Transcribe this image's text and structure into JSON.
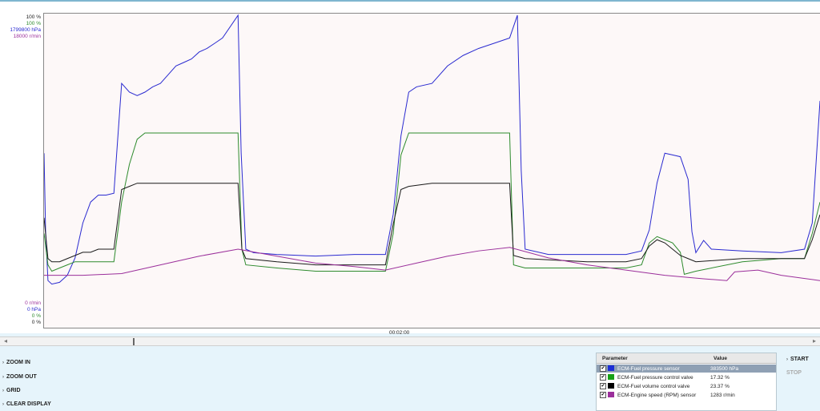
{
  "chart": {
    "y_axis_top": [
      {
        "label": "100 %",
        "color": "#1a1a1a"
      },
      {
        "label": "100 %",
        "color": "#2e8b2e"
      },
      {
        "label": "1799800 hPa",
        "color": "#2a2ad0"
      },
      {
        "label": "18000 r/min",
        "color": "#9b2f9b"
      }
    ],
    "y_axis_bottom": [
      {
        "label": "0 r/min",
        "color": "#9b2f9b"
      },
      {
        "label": "0 hPa",
        "color": "#2a2ad0"
      },
      {
        "label": "0 %",
        "color": "#2e8b2e"
      },
      {
        "label": "0 %",
        "color": "#1a1a1a"
      }
    ],
    "time_label": "00:02:00"
  },
  "chart_data": {
    "type": "line",
    "xlabel": "",
    "ylabel": "",
    "x_tick_labels": [
      "00:02:00"
    ],
    "grid": false,
    "series": [
      {
        "name": "ECM-Fuel pressure sensor",
        "color": "#2a2ad0",
        "unit": "hPa",
        "ylim": [
          0,
          1799800
        ],
        "points": [
          [
            0,
            1000000
          ],
          [
            0.2,
            560000
          ],
          [
            0.5,
            270000
          ],
          [
            1,
            250000
          ],
          [
            2,
            260000
          ],
          [
            3,
            300000
          ],
          [
            4,
            400000
          ],
          [
            5,
            600000
          ],
          [
            6,
            720000
          ],
          [
            7,
            760000
          ],
          [
            8,
            760000
          ],
          [
            9,
            770000
          ],
          [
            10,
            1400000
          ],
          [
            11,
            1350000
          ],
          [
            12,
            1330000
          ],
          [
            13,
            1350000
          ],
          [
            14,
            1380000
          ],
          [
            15,
            1400000
          ],
          [
            16,
            1450000
          ],
          [
            17,
            1500000
          ],
          [
            18,
            1520000
          ],
          [
            19,
            1540000
          ],
          [
            20,
            1580000
          ],
          [
            21,
            1600000
          ],
          [
            22,
            1630000
          ],
          [
            23,
            1660000
          ],
          [
            25,
            1790000
          ],
          [
            25.4,
            1000000
          ],
          [
            26,
            450000
          ],
          [
            27,
            430000
          ],
          [
            30,
            420000
          ],
          [
            35,
            410000
          ],
          [
            40,
            420000
          ],
          [
            44,
            420000
          ],
          [
            45,
            650000
          ],
          [
            46,
            1100000
          ],
          [
            47,
            1350000
          ],
          [
            48,
            1380000
          ],
          [
            50,
            1400000
          ],
          [
            52,
            1500000
          ],
          [
            54,
            1560000
          ],
          [
            56,
            1600000
          ],
          [
            58,
            1630000
          ],
          [
            60,
            1660000
          ],
          [
            61,
            1790000
          ],
          [
            61.5,
            900000
          ],
          [
            62,
            450000
          ],
          [
            65,
            420000
          ],
          [
            70,
            420000
          ],
          [
            75,
            420000
          ],
          [
            77,
            440000
          ],
          [
            78,
            560000
          ],
          [
            79,
            830000
          ],
          [
            80,
            1000000
          ],
          [
            81,
            990000
          ],
          [
            82,
            980000
          ],
          [
            83,
            850000
          ],
          [
            83.5,
            550000
          ],
          [
            84,
            430000
          ],
          [
            85,
            500000
          ],
          [
            86,
            450000
          ],
          [
            90,
            440000
          ],
          [
            95,
            430000
          ],
          [
            98,
            450000
          ],
          [
            99,
            600000
          ],
          [
            100,
            1300000
          ]
        ]
      },
      {
        "name": "ECM-Fuel pressure control valve",
        "color": "#2e8b2e",
        "unit": "%",
        "ylim": [
          0,
          100
        ],
        "points": [
          [
            0,
            30
          ],
          [
            0.5,
            20
          ],
          [
            1,
            18
          ],
          [
            2,
            19
          ],
          [
            3,
            20
          ],
          [
            4,
            21
          ],
          [
            5,
            21
          ],
          [
            6,
            21
          ],
          [
            7,
            21
          ],
          [
            8,
            21
          ],
          [
            9,
            21
          ],
          [
            10,
            40
          ],
          [
            11,
            52
          ],
          [
            12,
            60
          ],
          [
            13,
            62
          ],
          [
            14,
            62
          ],
          [
            16,
            62
          ],
          [
            18,
            62
          ],
          [
            20,
            62
          ],
          [
            22,
            62
          ],
          [
            24,
            62
          ],
          [
            25,
            62
          ],
          [
            25.5,
            25
          ],
          [
            26,
            20
          ],
          [
            30,
            19
          ],
          [
            35,
            18
          ],
          [
            40,
            18
          ],
          [
            44,
            18
          ],
          [
            45,
            30
          ],
          [
            46,
            55
          ],
          [
            47,
            62
          ],
          [
            50,
            62
          ],
          [
            55,
            62
          ],
          [
            60,
            62
          ],
          [
            60.5,
            20
          ],
          [
            62,
            19
          ],
          [
            70,
            19
          ],
          [
            75,
            19
          ],
          [
            77,
            20
          ],
          [
            78,
            27
          ],
          [
            79,
            29
          ],
          [
            80,
            28
          ],
          [
            81,
            27
          ],
          [
            82,
            24
          ],
          [
            82.5,
            17
          ],
          [
            84,
            18
          ],
          [
            90,
            21
          ],
          [
            95,
            22
          ],
          [
            98,
            22
          ],
          [
            99,
            30
          ],
          [
            100,
            40
          ]
        ]
      },
      {
        "name": "ECM-Fuel volume control valve",
        "color": "#1a1a1a",
        "unit": "%",
        "ylim": [
          0,
          100
        ],
        "points": [
          [
            0,
            35
          ],
          [
            0.5,
            22
          ],
          [
            1,
            21
          ],
          [
            2,
            21
          ],
          [
            3,
            22
          ],
          [
            4,
            23
          ],
          [
            5,
            24
          ],
          [
            6,
            24
          ],
          [
            7,
            25
          ],
          [
            8,
            25
          ],
          [
            9,
            25
          ],
          [
            10,
            44
          ],
          [
            11,
            45
          ],
          [
            12,
            46
          ],
          [
            13,
            46
          ],
          [
            16,
            46
          ],
          [
            20,
            46
          ],
          [
            24,
            46
          ],
          [
            25,
            46
          ],
          [
            25.5,
            25
          ],
          [
            26,
            22
          ],
          [
            30,
            21
          ],
          [
            35,
            20
          ],
          [
            40,
            20
          ],
          [
            44,
            20
          ],
          [
            45,
            33
          ],
          [
            46,
            44
          ],
          [
            47,
            45
          ],
          [
            50,
            46
          ],
          [
            55,
            46
          ],
          [
            60,
            46
          ],
          [
            60.5,
            23
          ],
          [
            62,
            22
          ],
          [
            70,
            21
          ],
          [
            75,
            21
          ],
          [
            77,
            22
          ],
          [
            78,
            26
          ],
          [
            79,
            28
          ],
          [
            80,
            27
          ],
          [
            81,
            25
          ],
          [
            82,
            23
          ],
          [
            83,
            22
          ],
          [
            84,
            21
          ],
          [
            90,
            22
          ],
          [
            95,
            22
          ],
          [
            98,
            22
          ],
          [
            99,
            28
          ],
          [
            100,
            36
          ]
        ]
      },
      {
        "name": "ECM-Engine speed (RPM) sensor",
        "color": "#9b2f9b",
        "unit": "r/min",
        "ylim": [
          0,
          18000
        ],
        "points": [
          [
            0,
            3000
          ],
          [
            1,
            3000
          ],
          [
            5,
            3000
          ],
          [
            10,
            3100
          ],
          [
            15,
            3600
          ],
          [
            20,
            4100
          ],
          [
            25,
            4500
          ],
          [
            30,
            4100
          ],
          [
            35,
            3700
          ],
          [
            40,
            3500
          ],
          [
            44,
            3300
          ],
          [
            48,
            3700
          ],
          [
            52,
            4100
          ],
          [
            56,
            4400
          ],
          [
            60,
            4600
          ],
          [
            65,
            4000
          ],
          [
            70,
            3600
          ],
          [
            75,
            3300
          ],
          [
            80,
            3000
          ],
          [
            85,
            2800
          ],
          [
            88,
            2700
          ],
          [
            89,
            3200
          ],
          [
            92,
            3300
          ],
          [
            95,
            3000
          ],
          [
            100,
            2700
          ]
        ]
      }
    ]
  },
  "controls": {
    "zoom_in": "ZOOM IN",
    "zoom_out": "ZOOM OUT",
    "grid": "GRID",
    "clear_display": "CLEAR DISPLAY",
    "start": "START",
    "stop": "STOP"
  },
  "parameters": {
    "header_parameter": "Parameter",
    "header_value": "Value",
    "rows": [
      {
        "name": "ECM-Fuel pressure sensor",
        "value": "383500 hPa",
        "color": "#1d2ed6",
        "checked": true,
        "selected": true
      },
      {
        "name": "ECM-Fuel pressure control valve",
        "value": "17.32 %",
        "color": "#16a016",
        "checked": true,
        "selected": false
      },
      {
        "name": "ECM-Fuel volume control valve",
        "value": "23.37 %",
        "color": "#000000",
        "checked": true,
        "selected": false
      },
      {
        "name": "ECM-Engine speed (RPM) sensor",
        "value": "1283 r/min",
        "color": "#9b2f9b",
        "checked": true,
        "selected": false
      }
    ]
  }
}
